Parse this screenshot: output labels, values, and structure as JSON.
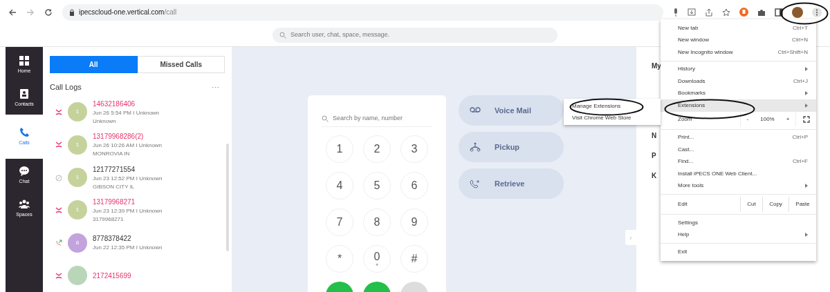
{
  "browser": {
    "url_host": "ipecscloud-one.vertical.com",
    "url_path": "/call"
  },
  "app_search": {
    "placeholder": "Search user, chat, space, message."
  },
  "nav": [
    {
      "label": "Home",
      "kind": "home",
      "selected": false
    },
    {
      "label": "Contacts",
      "kind": "contacts",
      "selected": false
    },
    {
      "label": "Calls",
      "kind": "calls",
      "selected": true
    },
    {
      "label": "Chat",
      "kind": "chat",
      "selected": false
    },
    {
      "label": "Spaces",
      "kind": "spaces",
      "selected": false
    }
  ],
  "call_tabs": [
    {
      "label": "All",
      "selected": true
    },
    {
      "label": "Missed Calls",
      "selected": false
    }
  ],
  "call_logs": {
    "title": "Call Logs",
    "more": "···",
    "items": [
      {
        "number": "14632186406",
        "kind": "missed",
        "avatar": "1",
        "color": "#c6d29c",
        "detail": "Jun 26 5:54 PM  I  Unknown",
        "location": "Unknown"
      },
      {
        "number": "13179968286(2)",
        "kind": "missed",
        "avatar": "1",
        "color": "#c6d29c",
        "detail": "Jun 26 10:26 AM  I  Unknown",
        "location": "MONROVIA IN"
      },
      {
        "number": "12177271554",
        "kind": "blocked",
        "avatar": "1",
        "color": "#c6d29c",
        "detail": "Jun 23 12:52 PM  I  Unknown",
        "location": "GIBSON CITY IL"
      },
      {
        "number": "13179968271",
        "kind": "missed",
        "avatar": "1",
        "color": "#c6d29c",
        "detail": "Jun 23 12:39 PM  I  Unknown",
        "location": "3179968271"
      },
      {
        "number": "8778378422",
        "kind": "outgoing",
        "avatar": "8",
        "color": "#c3a3dc",
        "detail": "Jun 22 12:35 PM  I  Unknown"
      },
      {
        "number": "2172415699",
        "kind": "missed",
        "color": "#b9d6b9"
      }
    ]
  },
  "dialpad": {
    "placeholder": "Search by name, number",
    "keys": [
      {
        "digit": "1"
      },
      {
        "digit": "2"
      },
      {
        "digit": "3"
      },
      {
        "digit": "4"
      },
      {
        "digit": "5"
      },
      {
        "digit": "6"
      },
      {
        "digit": "7"
      },
      {
        "digit": "8"
      },
      {
        "digit": "9"
      },
      {
        "digit": "*"
      },
      {
        "digit": "0",
        "sub": "+"
      },
      {
        "digit": "#"
      }
    ]
  },
  "actions": [
    {
      "label": "Voice Mail",
      "kind": "voicemail"
    },
    {
      "label": "Pickup",
      "kind": "pickup"
    },
    {
      "label": "Retrieve",
      "kind": "retrieve"
    }
  ],
  "right_panel": {
    "labels": [
      "My",
      "N",
      "P",
      "K"
    ]
  },
  "expand_button": "›",
  "menu": {
    "items": [
      {
        "kind": "item",
        "label": "New tab",
        "shortcut": "Ctrl+T"
      },
      {
        "kind": "item",
        "label": "New window",
        "shortcut": "Ctrl+N"
      },
      {
        "kind": "item",
        "label": "New Incognito window",
        "shortcut": "Ctrl+Shift+N"
      },
      {
        "kind": "separator"
      },
      {
        "kind": "item",
        "label": "History",
        "submenu": true
      },
      {
        "kind": "item",
        "label": "Downloads",
        "shortcut": "Ctrl+J"
      },
      {
        "kind": "item",
        "label": "Bookmarks",
        "submenu": true
      },
      {
        "kind": "item",
        "label": "Extensions",
        "submenu": true,
        "selected": true
      },
      {
        "kind": "zoom",
        "label": "Zoom",
        "minus": "-",
        "value": "100%",
        "plus": "+"
      },
      {
        "kind": "separator"
      },
      {
        "kind": "item",
        "label": "Print...",
        "shortcut": "Ctrl+P"
      },
      {
        "kind": "item",
        "label": "Cast..."
      },
      {
        "kind": "item",
        "label": "Find...",
        "shortcut": "Ctrl+F"
      },
      {
        "kind": "item",
        "label": "Install iPECS ONE Web Client..."
      },
      {
        "kind": "item",
        "label": "More tools",
        "submenu": true
      },
      {
        "kind": "separator"
      },
      {
        "kind": "edit",
        "label": "Edit",
        "buttons": [
          "Cut",
          "Copy",
          "Paste"
        ]
      },
      {
        "kind": "separator"
      },
      {
        "kind": "item",
        "label": "Settings"
      },
      {
        "kind": "item",
        "label": "Help",
        "submenu": true
      },
      {
        "kind": "separator"
      },
      {
        "kind": "item",
        "label": "Exit"
      }
    ]
  },
  "submenu": {
    "items": [
      "Manage Extensions",
      "Visit Chrome Web Store"
    ]
  }
}
